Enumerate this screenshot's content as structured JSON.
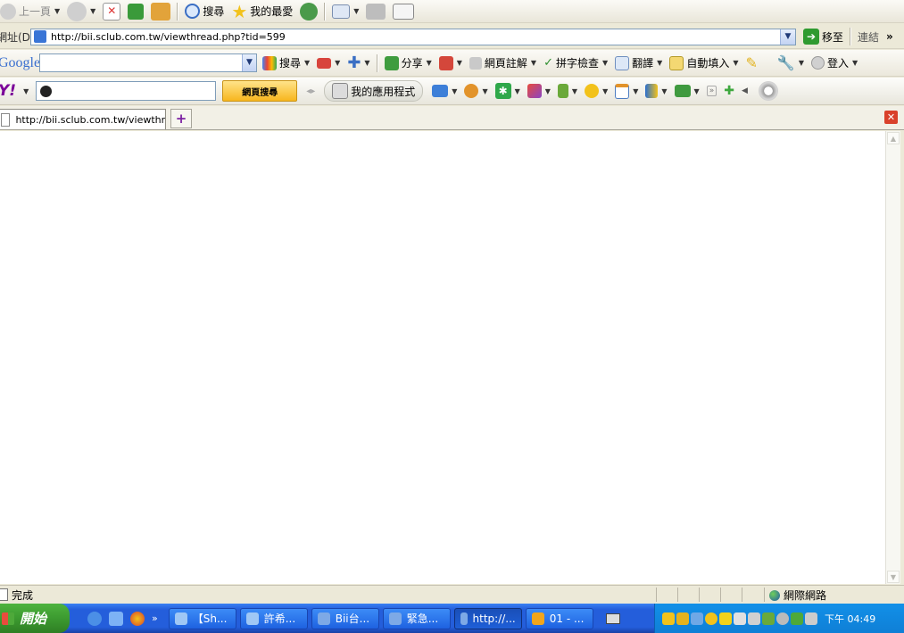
{
  "toolbar": {
    "back_label": "上一頁",
    "search_label": "搜尋",
    "favorites_label": "我的最愛"
  },
  "address": {
    "label": "網址(D)",
    "url": "http://bii.sclub.com.tw/viewthread.php?tid=599",
    "go_label": "移至",
    "links_label": "連結",
    "more": "»"
  },
  "google_bar": {
    "logo": "Google",
    "search_label": "搜尋",
    "share_label": "分享",
    "annotate_label": "網頁註解",
    "spellcheck_label": "拼字檢查",
    "translate_label": "翻譯",
    "autofill_label": "自動填入",
    "login_label": "登入"
  },
  "yahoo_bar": {
    "logo": "Y!",
    "search_button_label": "網頁搜尋",
    "apps_label": "我的應用程式"
  },
  "tab": {
    "title": "http://bii.sclub.com.tw/viewthread...",
    "new_tab": "+"
  },
  "status": {
    "text": "完成",
    "zone": "網際網路"
  },
  "taskbar": {
    "start_label": "開始",
    "overflow": "»",
    "items": [
      {
        "label": "【Sh..."
      },
      {
        "label": "許希..."
      },
      {
        "label": "Bii台..."
      },
      {
        "label": "緊急..."
      },
      {
        "label": "http://..."
      },
      {
        "label": "01 - ..."
      }
    ],
    "clock": "下午 04:49"
  },
  "colors": {
    "taskbar_blue": "#245edb",
    "start_green": "#3c9a30",
    "close_red": "#d9412b"
  }
}
